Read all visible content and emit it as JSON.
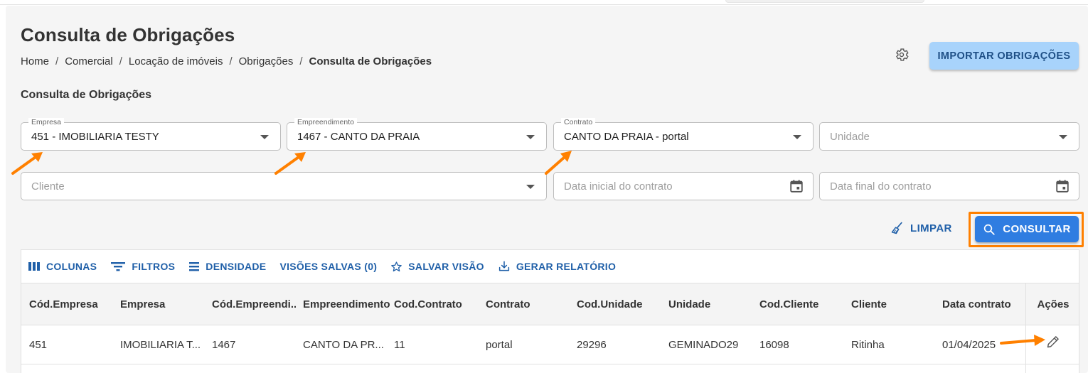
{
  "page": {
    "title": "Consulta de Obrigações",
    "breadcrumb": [
      "Home",
      "Comercial",
      "Locação de imóveis",
      "Obrigações",
      "Consulta de Obrigações"
    ],
    "import_button": "IMPORTAR OBRIGAÇÕES",
    "settings_icon": "gear-icon"
  },
  "form": {
    "section_title": "Consulta de Obrigações",
    "empresa": {
      "label": "Empresa",
      "value": "451 - IMOBILIARIA TESTY"
    },
    "empreendimento": {
      "label": "Empreendimento",
      "value": "1467 - CANTO DA PRAIA"
    },
    "contrato": {
      "label": "Contrato",
      "value": "CANTO DA PRAIA - portal"
    },
    "unidade": {
      "placeholder": "Unidade"
    },
    "cliente": {
      "placeholder": "Cliente"
    },
    "data_inicial": {
      "placeholder": "Data inicial do contrato"
    },
    "data_final": {
      "placeholder": "Data final do contrato"
    },
    "limpar": "LIMPAR",
    "consultar": "CONSULTAR"
  },
  "grid": {
    "toolbar": {
      "colunas": "COLUNAS",
      "filtros": "FILTROS",
      "densidade": "DENSIDADE",
      "visoes_salvas": "VISÕES SALVAS (0)",
      "salvar_visao": "SALVAR VISÃO",
      "gerar_relatorio": "GERAR RELATÓRIO"
    },
    "columns": [
      "Cód.Empresa",
      "Empresa",
      "Cód.Empreendi...",
      "Empreendimento",
      "Cod.Contrato",
      "Contrato",
      "Cod.Unidade",
      "Unidade",
      "Cod.Cliente",
      "Cliente",
      "Data contrato"
    ],
    "actions_header": "Ações",
    "rows": [
      [
        "451",
        "IMOBILIARIA T...",
        "1467",
        "CANTO DA PR...",
        "11",
        "portal",
        "29296",
        "GEMINADO29",
        "16098",
        "Ritinha",
        "01/04/2025"
      ]
    ]
  },
  "colors": {
    "accent": "#1f5fa8",
    "primary_button": "#2f7de1",
    "import_button": "#a8d3fb",
    "highlight_orange": "#ff8000"
  }
}
